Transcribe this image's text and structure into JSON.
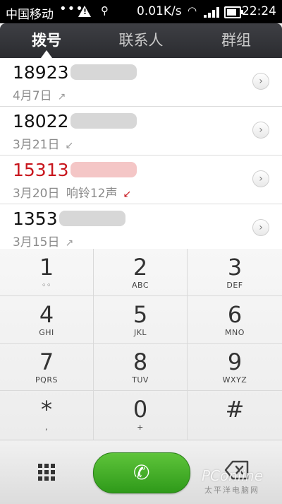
{
  "status_bar": {
    "carrier": "中国移动",
    "dots": "•••",
    "warning": "!",
    "speed": "0.01K/s",
    "time": "22:24",
    "icons": [
      "warning-icon",
      "usb-icon",
      "wifi-icon",
      "signal-icon",
      "battery-icon"
    ]
  },
  "tabs": [
    {
      "label": "拨号",
      "active": true
    },
    {
      "label": "联系人",
      "active": false
    },
    {
      "label": "群组",
      "active": false
    }
  ],
  "call_log": [
    {
      "number_visible": "18923",
      "date": "4月7日",
      "ring_info": "",
      "type": "outgoing",
      "missed": false
    },
    {
      "number_visible": "18022",
      "date": "3月21日",
      "ring_info": "",
      "type": "incoming",
      "missed": false
    },
    {
      "number_visible": "15313",
      "date": "3月20日",
      "ring_info": "响铃12声",
      "type": "missed",
      "missed": true
    },
    {
      "number_visible": "1353",
      "date": "3月15日",
      "ring_info": "",
      "type": "outgoing",
      "missed": false
    }
  ],
  "keypad": [
    {
      "digit": "1",
      "letters": "ᴏᴏ"
    },
    {
      "digit": "2",
      "letters": "ABC"
    },
    {
      "digit": "3",
      "letters": "DEF"
    },
    {
      "digit": "4",
      "letters": "GHI"
    },
    {
      "digit": "5",
      "letters": "JKL"
    },
    {
      "digit": "6",
      "letters": "MNO"
    },
    {
      "digit": "7",
      "letters": "PQRS"
    },
    {
      "digit": "8",
      "letters": "TUV"
    },
    {
      "digit": "9",
      "letters": "WXYZ"
    },
    {
      "digit": "*",
      "letters": ","
    },
    {
      "digit": "0",
      "letters": "+"
    },
    {
      "digit": "#",
      "letters": ""
    }
  ],
  "bottom_bar": {
    "call_icon": "phone-icon",
    "dialpad_icon": "dialpad-grid-icon",
    "delete_icon": "backspace-icon",
    "watermark": "PConline",
    "watermark_sub": "太平洋电脑网"
  },
  "colors": {
    "tab_bar": "#333438",
    "missed_call": "#c8161d",
    "call_button": "#3fae22"
  }
}
